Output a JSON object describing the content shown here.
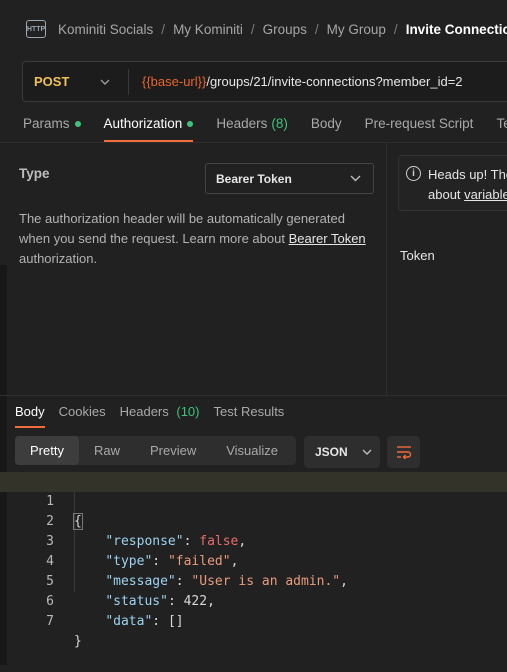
{
  "breadcrumb": {
    "icon_label": "HTTP",
    "items": [
      "Kominiti Socials",
      "My Kominiti",
      "Groups",
      "My Group"
    ],
    "current": "Invite Connection",
    "separator": "/"
  },
  "request": {
    "method": "POST",
    "url_variable": "{{base-url}}",
    "url_path": "/groups/21/invite-connections?member_id=2"
  },
  "request_tabs": [
    {
      "label": "Params",
      "dot": true
    },
    {
      "label": "Authorization",
      "dot": true
    },
    {
      "label": "Headers",
      "count": "(8)"
    },
    {
      "label": "Body"
    },
    {
      "label": "Pre-request Script"
    },
    {
      "label": "Tes"
    }
  ],
  "authorization": {
    "type_label": "Type",
    "type_value": "Bearer Token",
    "description_prefix": "The authorization header will be automatically generated when you send the request. Learn more about ",
    "description_link": "Bearer Token",
    "description_suffix": "authorization.",
    "notice_line1": "Heads up! The",
    "notice_line2_prefix": "about ",
    "notice_link": "variable",
    "token_label": "Token"
  },
  "response_tabs": [
    {
      "label": "Body"
    },
    {
      "label": "Cookies"
    },
    {
      "label": "Headers",
      "count": "(10)"
    },
    {
      "label": "Test Results"
    }
  ],
  "response_view": {
    "modes": [
      "Pretty",
      "Raw",
      "Preview",
      "Visualize"
    ],
    "format": "JSON"
  },
  "response_body": {
    "lines": [
      "1",
      "2",
      "3",
      "4",
      "5",
      "6",
      "7"
    ],
    "open_brace": "{",
    "close_brace": "}",
    "response_key": "\"response\"",
    "response_value": "false",
    "type_key": "\"type\"",
    "type_value": "\"failed\"",
    "message_key": "\"message\"",
    "message_value": "\"User is an admin.\"",
    "status_key": "\"status\"",
    "status_value": "422",
    "data_key": "\"data\"",
    "data_value": "[]"
  },
  "colors": {
    "accent": "#f26b3a",
    "method": "#f0c05a",
    "variable": "#e8662d",
    "success_dot": "#3dc37b"
  }
}
